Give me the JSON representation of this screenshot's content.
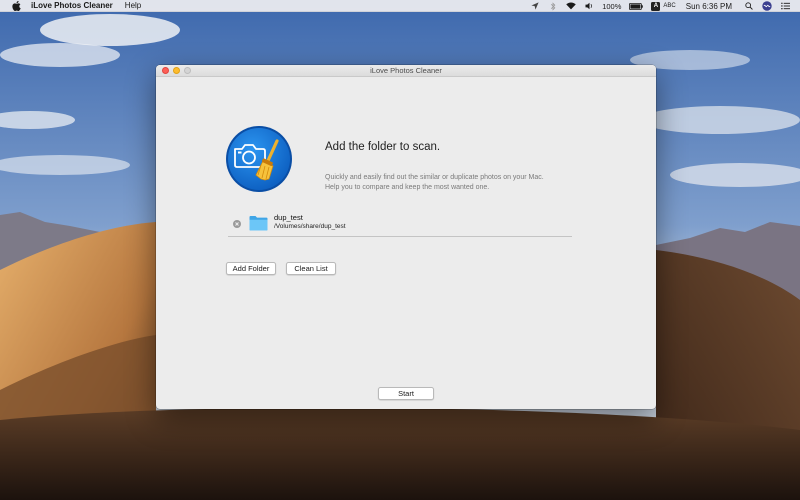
{
  "menubar": {
    "app_name": "iLove Photos Cleaner",
    "menu_help": "Help",
    "battery": "100%",
    "input_badge": "A",
    "input_source": "ABC",
    "clock": "Sun 6:36 PM"
  },
  "window": {
    "title": "iLove Photos Cleaner",
    "heading": "Add the folder to scan.",
    "description_line1": "Quickly and easily find out the similar or duplicate photos on your Mac.",
    "description_line2": "Help you to compare and keep the most wanted one.",
    "folders": [
      {
        "name": "dup_test",
        "path": "/Volumes/share/dup_test"
      }
    ],
    "buttons": {
      "add_folder": "Add Folder",
      "clean_list": "Clean List",
      "start": "Start"
    }
  },
  "colors": {
    "logo_blue": "#1572d8",
    "folder_blue": "#5ab9f2",
    "close": "#fd5f57",
    "minimize": "#fdbc2e"
  },
  "icons": {
    "menubar": [
      "apple-icon",
      "location-arrow-icon",
      "bluetooth-icon",
      "wifi-icon",
      "volume-icon",
      "battery-icon",
      "spotlight-search-icon",
      "siri-icon",
      "notification-center-icon"
    ],
    "app": [
      "app-logo-icon",
      "remove-icon",
      "folder-icon"
    ]
  }
}
